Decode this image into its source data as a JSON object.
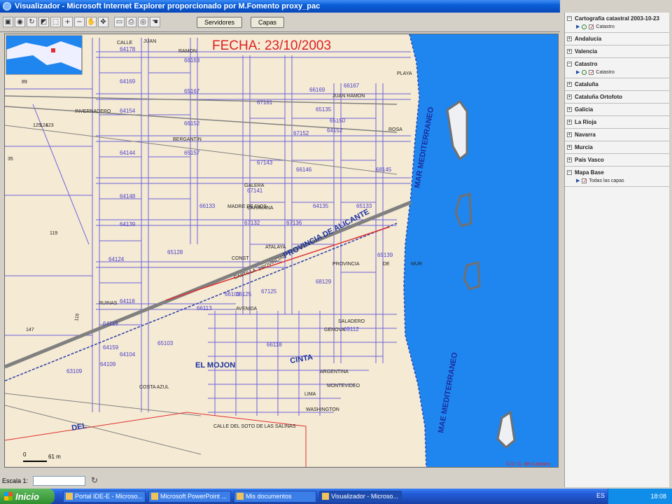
{
  "window": {
    "title": "Visualizador - Microsoft Internet Explorer proporcionado por M.Fomento proxy_pac"
  },
  "toolbar": {
    "servers_label": "Servidores",
    "layers_label": "Capas",
    "tools": [
      "save-icon",
      "globe-icon",
      "refresh-icon",
      "select-icon",
      "zoom-window-icon",
      "zoom-in-icon",
      "zoom-out-icon",
      "pan-icon",
      "move-icon",
      "measure-icon",
      "print-icon",
      "camera-icon",
      "hand-icon"
    ]
  },
  "map": {
    "date_label": "FECHA: 23/10/2003",
    "copyright": "© D. G. del Catastro",
    "scale_bar": {
      "zero": "0",
      "distance": "61 m"
    },
    "parcel_labels": [
      "64178",
      "66163",
      "64169",
      "65167",
      "67161",
      "64154",
      "64152",
      "66152",
      "65157",
      "64144",
      "67143",
      "66146",
      "64148",
      "66133",
      "65133",
      "67132",
      "67136",
      "64139",
      "64124",
      "65128",
      "64118",
      "66125",
      "67125",
      "68129",
      "64119",
      "66113",
      "69112",
      "64109",
      "63109",
      "66169",
      "64159",
      "66118",
      "66103",
      "65103",
      "64104",
      "67141",
      "67152",
      "69139",
      "68145",
      "64135",
      "65135",
      "65150",
      "66167"
    ],
    "street_labels": [
      "CALLE",
      "RAMON",
      "JUAN",
      "JUAN RAMON",
      "INVERNADERO",
      "BERGANTIN",
      "GALERA",
      "MADRE DE DIOS",
      "CARAVANA",
      "ATALAYA",
      "PROVINCIAL",
      "PROVINCIA DE ALICANTE",
      "PROVINCIA",
      "DE",
      "MUR",
      "AVENIDA",
      "SALADERO",
      "GENOVA",
      "EL MOJON",
      "CINTA",
      "ARGENTINA",
      "MONTEVIDEO",
      "LIMA",
      "WASHINGTON",
      "COSTA AZUL",
      "CALLE DEL SOTO DE LAS SALINAS",
      "RUINAS",
      "DEL",
      "CONST",
      "MAR MEDITERRANEO",
      "MAE MEDITERRANEO",
      "PLAYA",
      "ROSA",
      "CASTILLA",
      "123",
      "125",
      "124",
      "147",
      "116",
      "119",
      "35",
      "89"
    ]
  },
  "layers": {
    "items": [
      {
        "label": "Cartografía catastral 2003-10-23",
        "expanded": true,
        "sub": "Catastro"
      },
      {
        "label": "Andalucía",
        "expanded": false
      },
      {
        "label": "Valencia",
        "expanded": false
      },
      {
        "label": "Catastro",
        "expanded": true,
        "sub": "Catastro"
      },
      {
        "label": "Cataluña",
        "expanded": false
      },
      {
        "label": "Cataluña Ortofoto",
        "expanded": false
      },
      {
        "label": "Galicia",
        "expanded": false
      },
      {
        "label": "La Rioja",
        "expanded": false
      },
      {
        "label": "Navarra",
        "expanded": false
      },
      {
        "label": "Murcia",
        "expanded": false
      },
      {
        "label": "País Vasco",
        "expanded": false
      },
      {
        "label": "Mapa Base",
        "expanded": true,
        "sub": "Todas las capas"
      }
    ]
  },
  "statusbar": {
    "scale_label": "Escala 1:",
    "scale_value": ""
  },
  "taskbar": {
    "start_label": "Inicio",
    "tasks": [
      {
        "label": "Portal IDE-E - Microso...",
        "active": false
      },
      {
        "label": "Microsoft PowerPoint ...",
        "active": false
      },
      {
        "label": "Mis documentos",
        "active": false
      },
      {
        "label": "Visualizador - Microso...",
        "active": true
      }
    ],
    "language": "ES",
    "clock": "18:08"
  },
  "colors": {
    "land": "#f5ead4",
    "sea": "#1f86f0",
    "parcel_lines": "#6c63d8",
    "date_label": "#e02020",
    "road": "#808080",
    "titlebar": "#0a5fd8"
  }
}
